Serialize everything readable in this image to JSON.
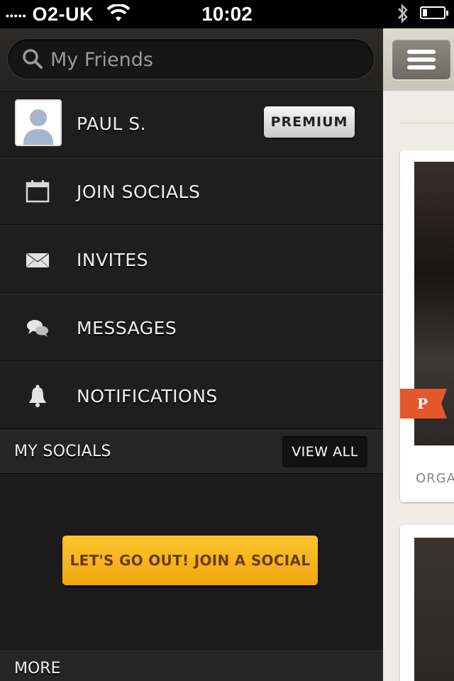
{
  "status_bar": {
    "carrier_dots": "•••••",
    "carrier": "O2-UK",
    "time": "10:02",
    "battery_level": 0.15
  },
  "search": {
    "placeholder": "My Friends"
  },
  "profile": {
    "name": "PAUL  S.",
    "badge": "PREMIUM"
  },
  "menu_items": [
    {
      "label": "JOIN SOCIALS",
      "icon": "calendar-icon"
    },
    {
      "label": "INVITES",
      "icon": "envelope-icon"
    },
    {
      "label": "MESSAGES",
      "icon": "chat-bubbles-icon"
    },
    {
      "label": "NOTIFICATIONS",
      "icon": "bell-icon"
    }
  ],
  "my_socials": {
    "title": "MY SOCIALS",
    "view_all": "VIEW ALL",
    "cta": "LET'S GO OUT! JOIN A SOCIAL"
  },
  "more": {
    "title": "MORE"
  },
  "content_peek": {
    "badge_letter": "P",
    "caption": "ORGA",
    "accent_color": "#e4572a"
  },
  "colors": {
    "cta": "#f5b21c",
    "menu_bg": "#1c1b1b"
  }
}
